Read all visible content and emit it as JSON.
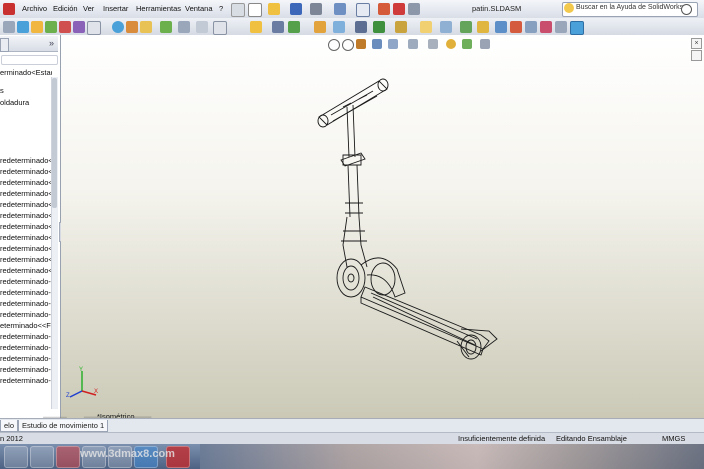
{
  "menu": {
    "items": [
      "Archivo",
      "Edición",
      "Ver",
      "Insertar",
      "Herramientas",
      "Ventana",
      "?"
    ]
  },
  "window": {
    "document_title": "patin.SLDASM"
  },
  "search": {
    "placeholder": "Buscar en la Ayuda de SolidWorks"
  },
  "feature_tree": {
    "rows": [
      "erminado<Estado",
      "s",
      "oldadura",
      "redeterminado<",
      "redeterminado<",
      "redeterminado<",
      "redeterminado<",
      "redeterminado<",
      "redeterminado<",
      "redeterminado<",
      "redeterminado<",
      "redeterminado<",
      "redeterminado<",
      "redeterminado<",
      "redeterminado-",
      "redeterminado-",
      "redeterminado-",
      "redeterminado-",
      "eterminado<<F",
      "redeterminado-",
      "redeterminado-",
      "redeterminado-",
      "redeterminado-",
      "redeterminado-"
    ]
  },
  "viewport": {
    "view_label": "*Isométrico"
  },
  "bottom_tabs": [
    "elo",
    "Estudio de movimiento 1"
  ],
  "status": {
    "year": "n 2012",
    "constraint": "Insuficientemente definida",
    "mode": "Editando Ensamblaje",
    "units": "MMGS"
  },
  "watermark": {
    "main": "天西网",
    "sub": "www.3dmax8.com"
  },
  "colors": {
    "viewport_top": "#ffffff",
    "viewport_bottom": "#cbc9b6",
    "taskbar": "#4d6283"
  }
}
